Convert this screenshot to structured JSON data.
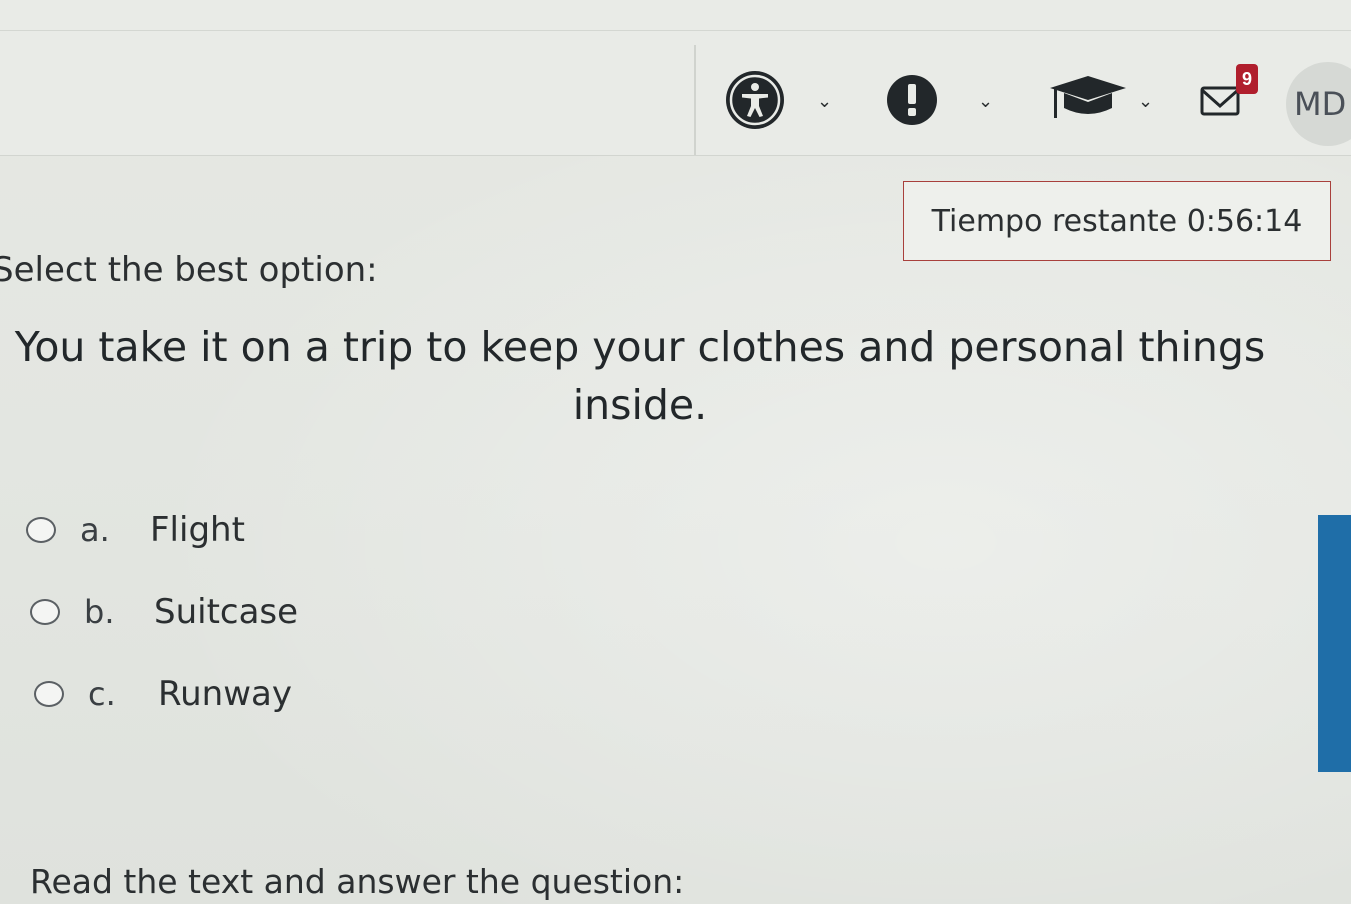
{
  "nav": {
    "accessibility_icon": "accessibility-icon",
    "alert_icon": "exclamation-icon",
    "courses_icon": "graduation-cap-icon",
    "messages_icon": "envelope-icon",
    "messages_count": "9",
    "avatar_initials": "MD"
  },
  "timer": {
    "label": "Tiempo restante",
    "value": "0:56:14"
  },
  "quiz": {
    "instruction": "Select the best option:",
    "question": "You take it on a trip to keep your clothes and personal things inside.",
    "options": [
      {
        "letter": "a.",
        "text": "Flight"
      },
      {
        "letter": "b.",
        "text": "Suitcase"
      },
      {
        "letter": "c.",
        "text": "Runway"
      }
    ],
    "next_instruction": "Read the text and answer the question:"
  },
  "colors": {
    "timer_border": "#a8403c",
    "badge": "#b01e2d",
    "accent_bar": "#1f6ea8"
  }
}
